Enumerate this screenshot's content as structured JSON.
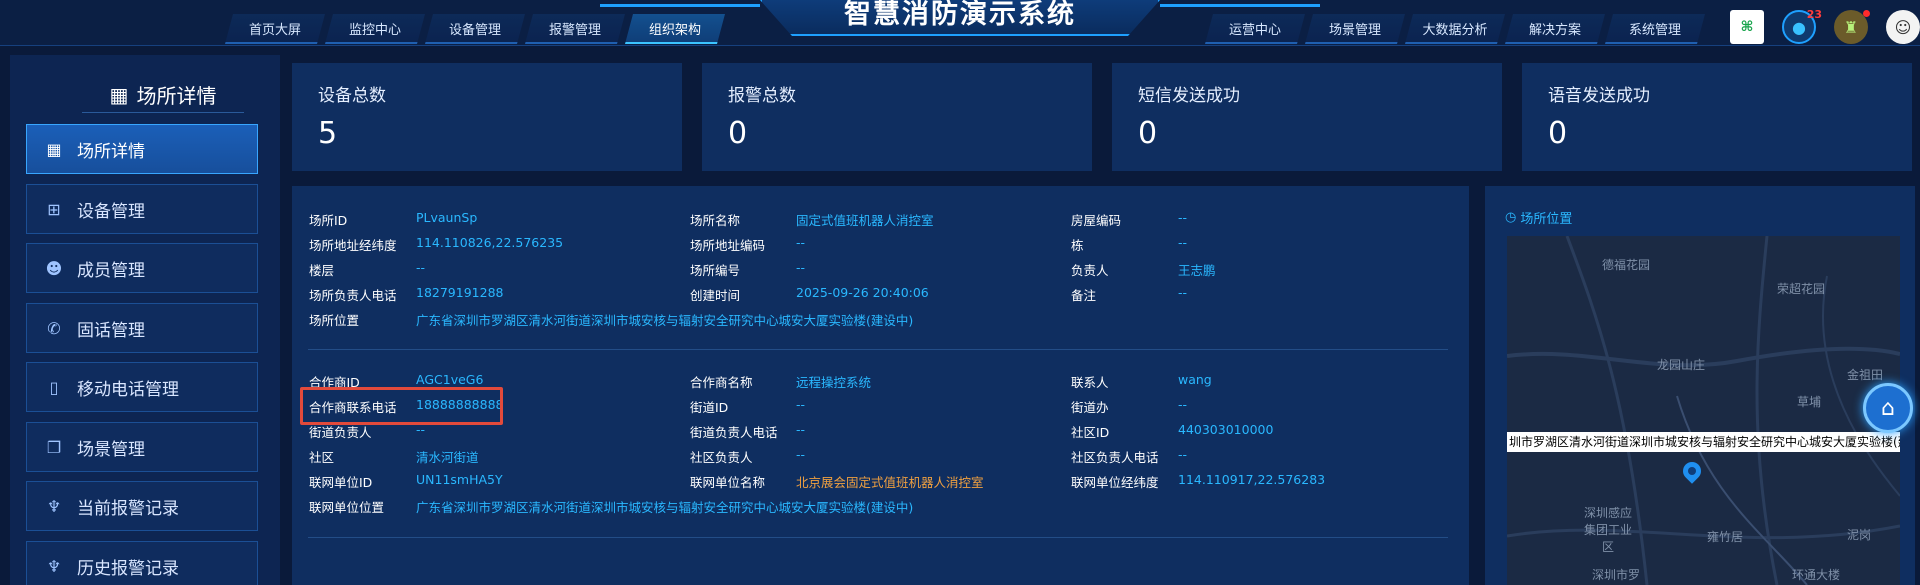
{
  "header": {
    "title": "智慧消防演示系统",
    "nav_left": [
      "首页大屏",
      "监控中心",
      "设备管理",
      "报警管理",
      "组织架构"
    ],
    "nav_right": [
      "运营中心",
      "场景管理",
      "大数据分析",
      "解决方案",
      "系统管理"
    ],
    "active_nav": "组织架构",
    "qr_icon": "qr-code-icon",
    "user_badge": "23"
  },
  "sidebar": {
    "title": "场所详情",
    "items": [
      {
        "label": "场所详情",
        "icon": "building-icon"
      },
      {
        "label": "设备管理",
        "icon": "grid-icon"
      },
      {
        "label": "成员管理",
        "icon": "users-icon"
      },
      {
        "label": "固话管理",
        "icon": "phone-icon"
      },
      {
        "label": "移动电话管理",
        "icon": "mobile-icon"
      },
      {
        "label": "场景管理",
        "icon": "layers-icon"
      },
      {
        "label": "当前报警记录",
        "icon": "alarm-icon"
      },
      {
        "label": "历史报警记录",
        "icon": "alarm-icon"
      }
    ]
  },
  "stats": [
    {
      "label": "设备总数",
      "value": "5"
    },
    {
      "label": "报警总数",
      "value": "0"
    },
    {
      "label": "短信发送成功",
      "value": "0"
    },
    {
      "label": "语音发送成功",
      "value": "0"
    }
  ],
  "site": {
    "id_label": "场所ID",
    "id": "PLvaunSp",
    "name_label": "场所名称",
    "name": "固定式值班机器人消控室",
    "room_label": "房屋编码",
    "room": "--",
    "coords_label": "场所地址经纬度",
    "coords": "114.110826,22.576235",
    "addrcode_label": "场所地址编码",
    "addrcode": "--",
    "building_label": "栋",
    "building": "--",
    "floor_label": "楼层",
    "floor": "--",
    "code_label": "场所编号",
    "code": "--",
    "owner_label": "负责人",
    "owner": "王志鹏",
    "owner_phone_label": "场所负责人电话",
    "owner_phone": "18279191288",
    "created_label": "创建时间",
    "created": "2025-09-26 20:40:06",
    "note_label": "备注",
    "note": "--",
    "location_label": "场所位置",
    "location": "广东省深圳市罗湖区清水河街道深圳市城安核与辐射安全研究中心城安大厦实验楼(建设中)"
  },
  "partner": {
    "id_label": "合作商ID",
    "id": "AGC1veG6",
    "name_label": "合作商名称",
    "name": "远程操控系统",
    "contact_label": "联系人",
    "contact": "wang",
    "phone_label": "合作商联系电话",
    "phone": "18888888888",
    "street_id_label": "街道ID",
    "street_id": "--",
    "street_office_label": "街道办",
    "street_office": "--",
    "street_owner_label": "街道负责人",
    "street_owner": "--",
    "street_phone_label": "街道负责人电话",
    "street_phone": "--",
    "community_id_label": "社区ID",
    "community_id": "440303010000",
    "community_label": "社区",
    "community": "清水河街道",
    "community_owner_label": "社区负责人",
    "community_owner": "--",
    "community_phone_label": "社区负责人电话",
    "community_phone": "--",
    "unit_id_label": "联网单位ID",
    "unit_id": "UN11smHA5Y",
    "unit_name_label": "联网单位名称",
    "unit_name": "北京展会固定式值班机器人消控室",
    "unit_coords_label": "联网单位经纬度",
    "unit_coords": "114.110917,22.576283",
    "unit_location_label": "联网单位位置",
    "unit_location": "广东省深圳市罗湖区清水河街道深圳市城安核与辐射安全研究中心城安大厦实验楼(建设中)"
  },
  "map": {
    "title": "场所位置",
    "labels": [
      "德福花园",
      "荣超花园",
      "龙园山庄",
      "金祖田",
      "草埔",
      "深圳感应集团工业区",
      "雍竹居",
      "深圳市罗",
      "泥岗",
      "环通大楼"
    ],
    "banner": "圳市罗湖区清水河街道深圳市城安核与辐射安全研究中心城安大厦实验楼(建"
  }
}
